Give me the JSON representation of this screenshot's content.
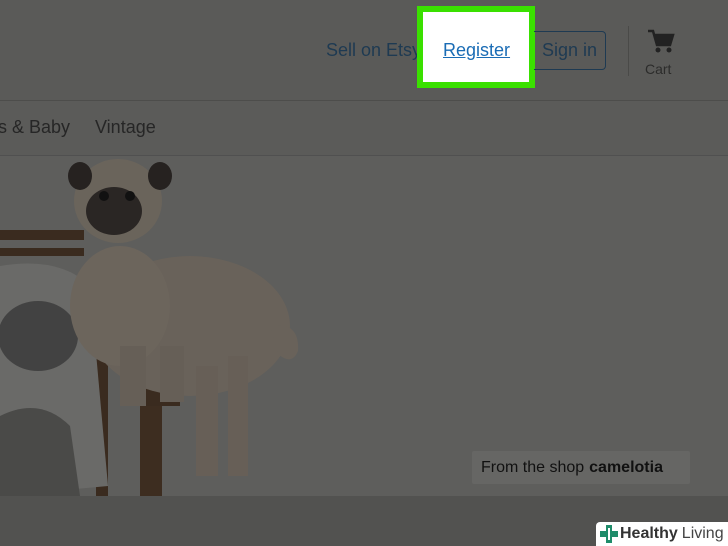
{
  "header": {
    "sell_link": "Sell on Etsy",
    "register_link": "Register",
    "signin_button": "Sign in",
    "cart_label": "Cart"
  },
  "category_nav": {
    "items": [
      "s & Baby",
      "Vintage"
    ]
  },
  "hero": {
    "caption_prefix": "From the shop",
    "caption_shop": "camelotia"
  },
  "watermark": {
    "brand_part1": "Healthy",
    "brand_part2": "Living"
  },
  "colors": {
    "highlight": "#3ae000",
    "link": "#1a6cb5",
    "overlay_gray": "#5b5b59"
  },
  "icons": [
    "cart-icon",
    "plus-cross-logo"
  ]
}
